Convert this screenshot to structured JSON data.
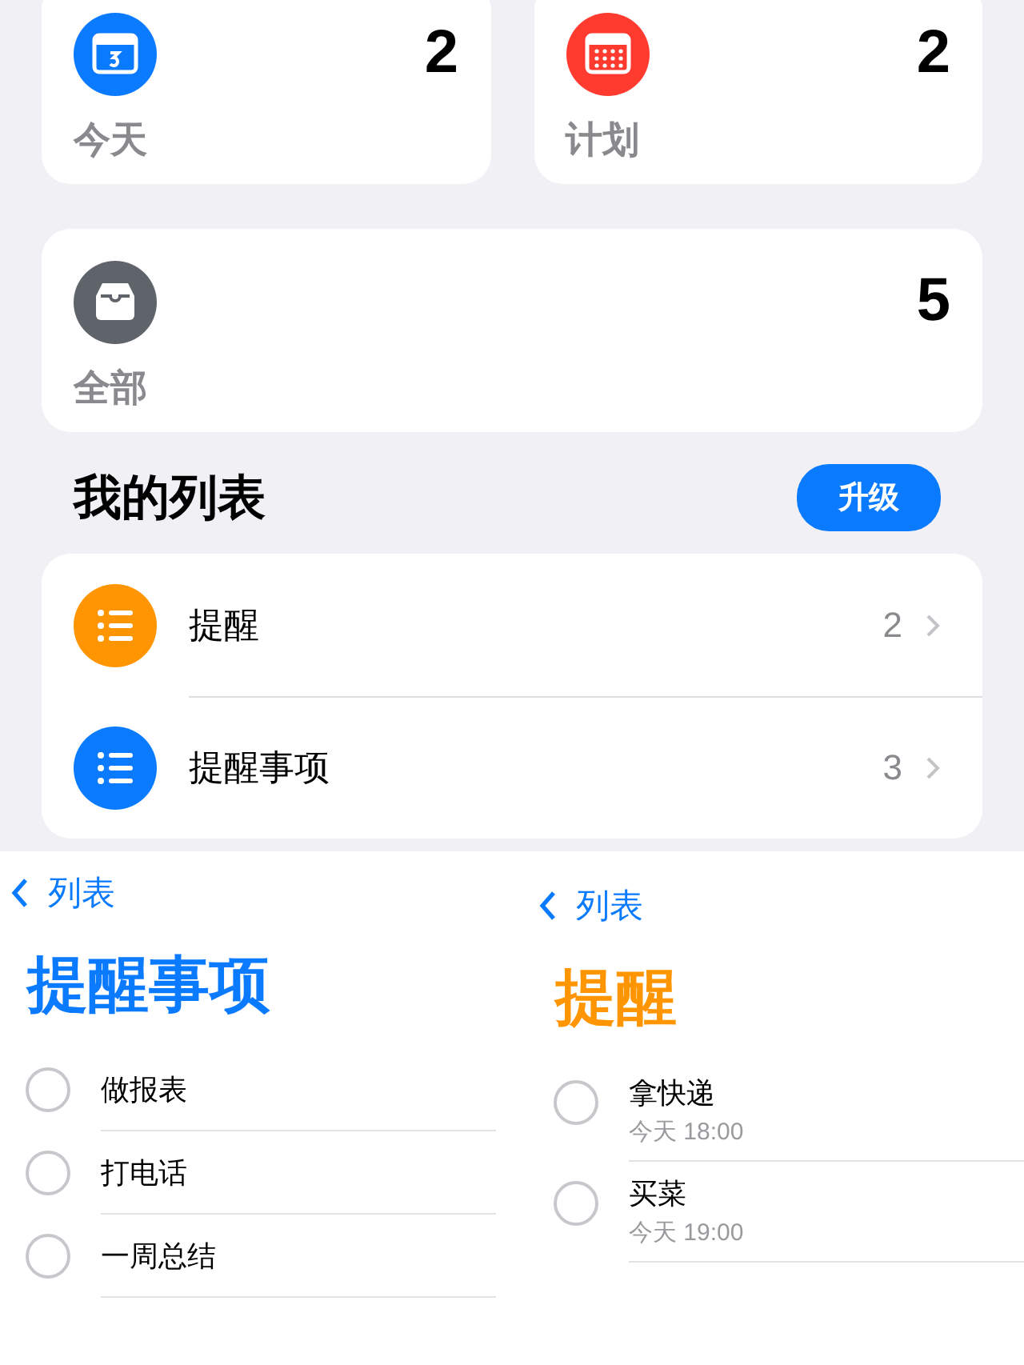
{
  "smart_lists": [
    {
      "kind": "today",
      "label": "今天",
      "count": "2",
      "color": "#0a7aff"
    },
    {
      "kind": "scheduled",
      "label": "计划",
      "count": "2",
      "color": "#ff3b30"
    },
    {
      "kind": "all",
      "label": "全部",
      "count": "5",
      "color": "#5f636a"
    }
  ],
  "my_lists": {
    "title": "我的列表",
    "upgrade_button": "升级",
    "items": [
      {
        "name": "提醒",
        "count": "2",
        "color": "#ff9500"
      },
      {
        "name": "提醒事项",
        "count": "3",
        "color": "#0a7aff"
      }
    ]
  },
  "detail_views": [
    {
      "back": "列表",
      "title": "提醒事项",
      "color": "#0a7aff",
      "reminders": [
        {
          "title": "做报表",
          "checked": false
        },
        {
          "title": "打电话",
          "checked": false
        },
        {
          "title": "一周总结",
          "checked": false
        }
      ]
    },
    {
      "back": "列表",
      "title": "提醒",
      "color": "#ff9500",
      "reminders": [
        {
          "title": "拿快递",
          "due": "今天 18:00",
          "checked": false
        },
        {
          "title": "买菜",
          "due": "今天 19:00",
          "checked": false
        }
      ]
    }
  ]
}
